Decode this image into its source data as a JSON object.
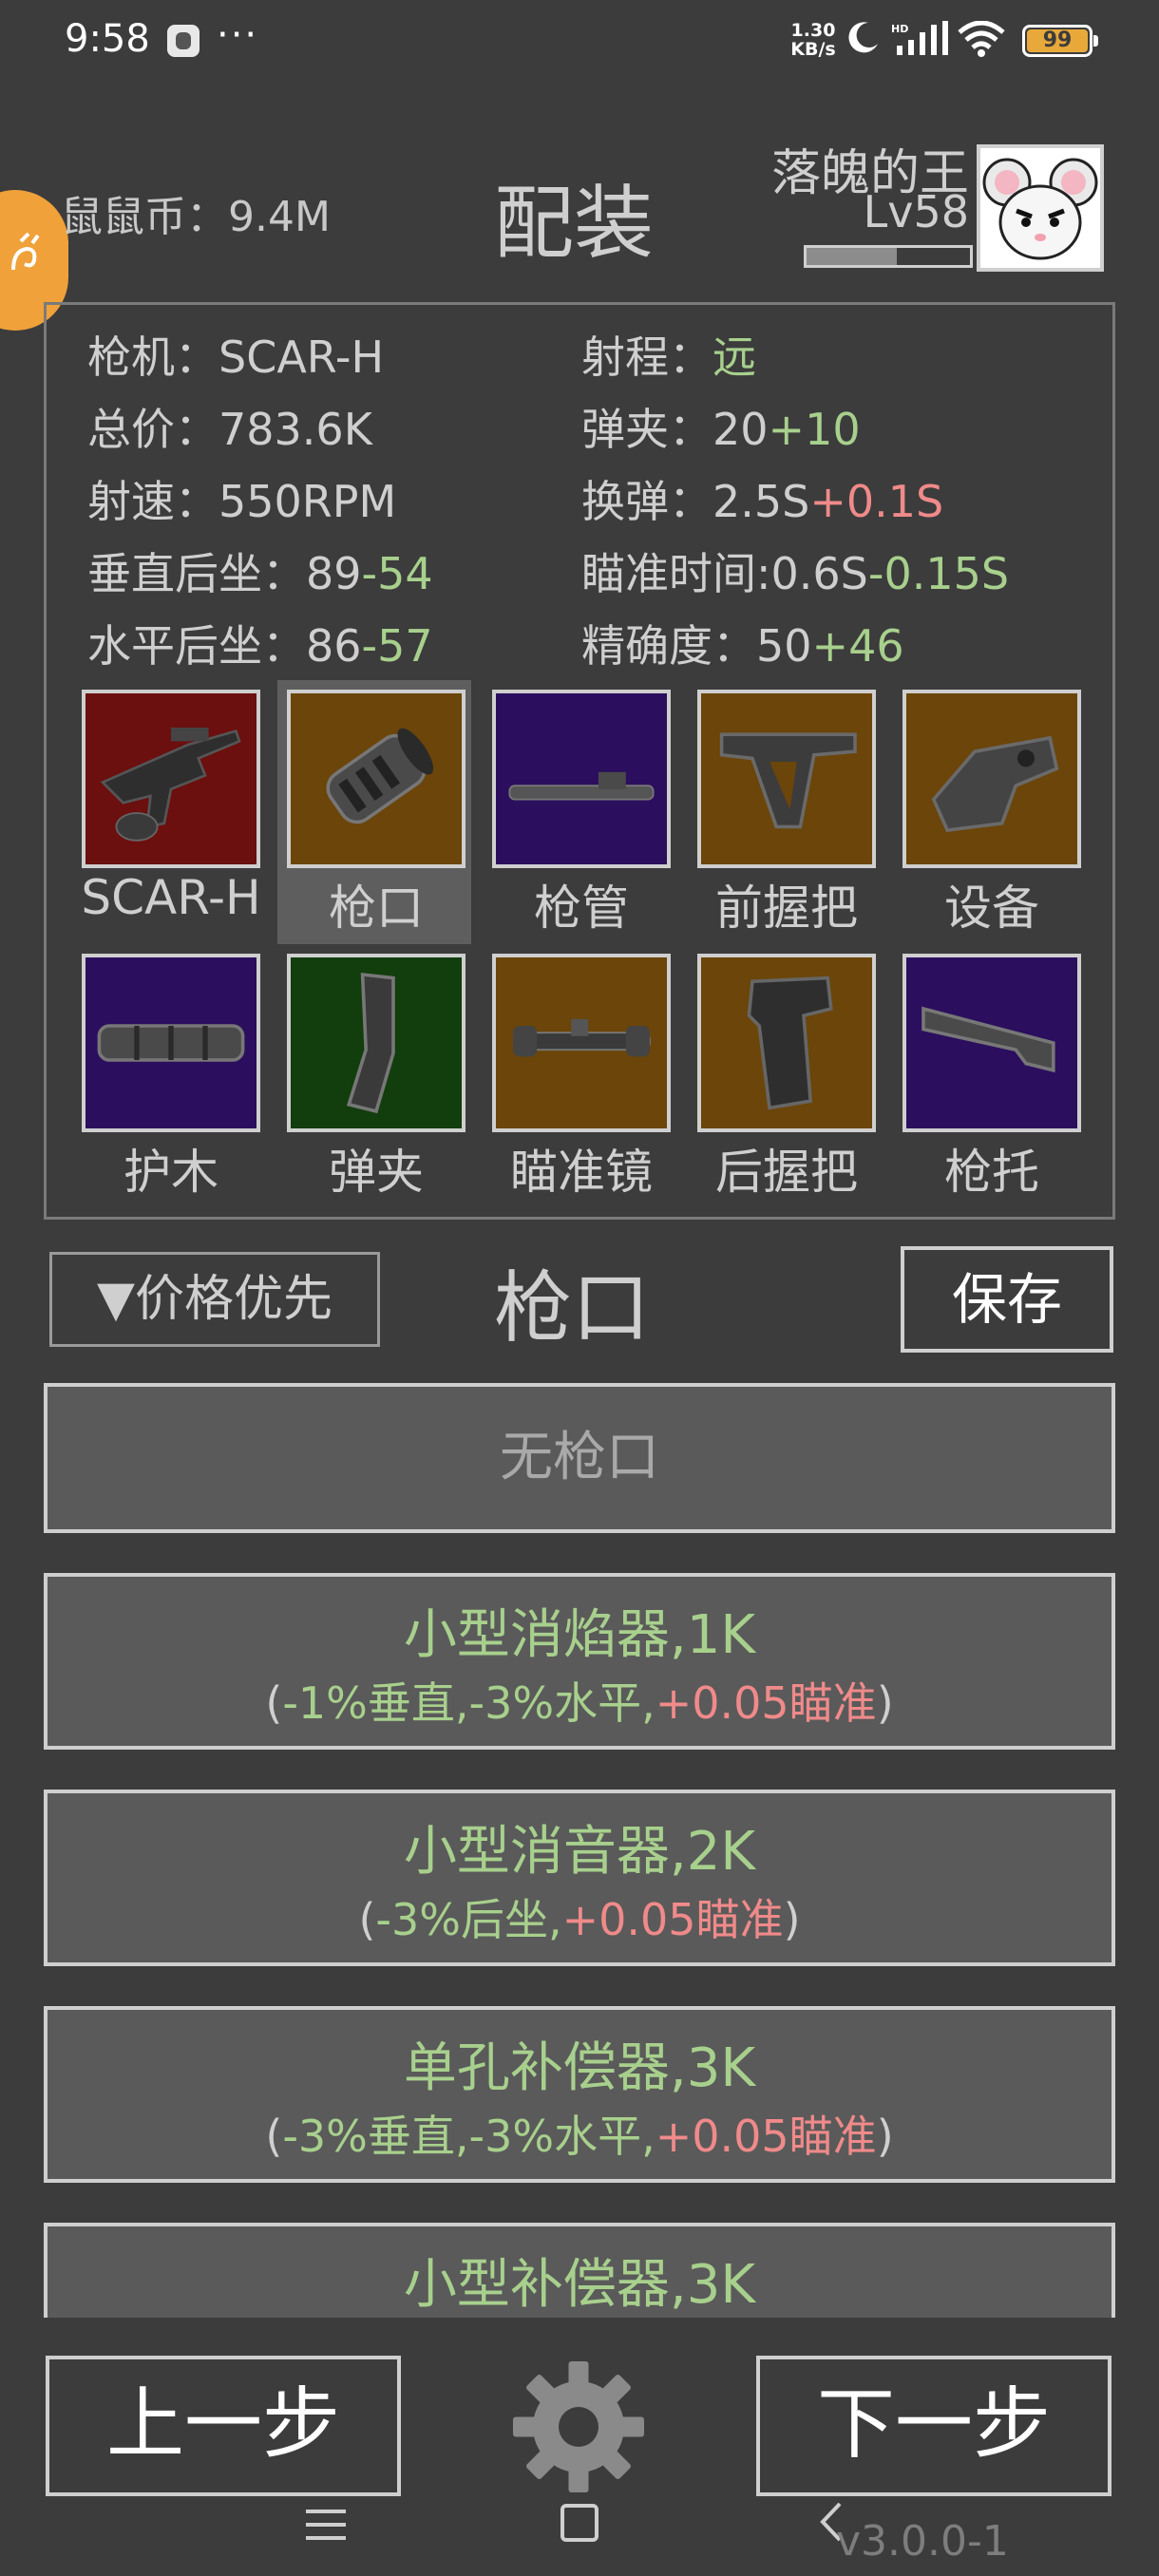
{
  "status_bar": {
    "time": "9:58",
    "dots": "···",
    "speed": "1.30\nKB/s",
    "battery": "99"
  },
  "header": {
    "coin_label": "鼠鼠币：9.4M",
    "title": "配装",
    "player_name": "落魄的王",
    "player_level": "Lv58",
    "xp_progress": 0.55
  },
  "stats": {
    "gun_label": "枪机：",
    "gun_value": "SCAR-H",
    "range_label": "射程：",
    "range_value": "远",
    "price_label": "总价：",
    "price_value": "783.6K",
    "mag_label": "弹夹：",
    "mag_base": "20",
    "mag_mod": "+10",
    "rof_label": "射速：",
    "rof_value": "550RPM",
    "reload_label": "换弹：",
    "reload_base": "2.5S",
    "reload_mod": "+0.1S",
    "vrecoil_label": "垂直后坐：",
    "vrecoil_base": "89",
    "vrecoil_mod": "-54",
    "ads_label": "瞄准时间:",
    "ads_base": "0.6S",
    "ads_mod": "-0.15S",
    "hrecoil_label": "水平后坐：",
    "hrecoil_base": "86",
    "hrecoil_mod": "-57",
    "acc_label": "精确度：",
    "acc_base": "50",
    "acc_mod": "+46"
  },
  "slots": [
    {
      "label": "SCAR-H",
      "icon": "rifle-icon",
      "rarity_color": "#6b0f0f"
    },
    {
      "label": "枪口",
      "icon": "muzzle-icon",
      "rarity_color": "#6b4509"
    },
    {
      "label": "枪管",
      "icon": "barrel-icon",
      "rarity_color": "#2b0f5e"
    },
    {
      "label": "前握把",
      "icon": "foregrip-icon",
      "rarity_color": "#6b4509"
    },
    {
      "label": "设备",
      "icon": "device-icon",
      "rarity_color": "#6b4509"
    },
    {
      "label": "护木",
      "icon": "handguard-icon",
      "rarity_color": "#2b0f5e"
    },
    {
      "label": "弹夹",
      "icon": "magazine-icon",
      "rarity_color": "#123d0c"
    },
    {
      "label": "瞄准镜",
      "icon": "scope-icon",
      "rarity_color": "#6b4509"
    },
    {
      "label": "后握把",
      "icon": "pistol-grip-icon",
      "rarity_color": "#6b4509"
    },
    {
      "label": "枪托",
      "icon": "stock-icon",
      "rarity_color": "#2b0f5e"
    }
  ],
  "controls": {
    "sort_label": "▼价格优先",
    "section_title": "枪口",
    "save_label": "保存"
  },
  "list": {
    "none_label": "无枪口",
    "items": [
      {
        "name": "小型消焰器,1K",
        "p1": "(",
        "g1": "-1%垂直,-3%水平,",
        "r1": "+0.05瞄准",
        "p2": ")"
      },
      {
        "name": "小型消音器,2K",
        "p1": "(",
        "g1": "-3%后坐,",
        "r1": "+0.05瞄准",
        "p2": ")"
      },
      {
        "name": "单孔补偿器,3K",
        "p1": "(",
        "g1": "-3%垂直,-3%水平,",
        "r1": "+0.05瞄准",
        "p2": ")"
      },
      {
        "name": "小型补偿器,3K"
      }
    ]
  },
  "bottom": {
    "prev_label": "上一步",
    "next_label": "下一步",
    "version": "v3.0.0-1"
  },
  "colors": {
    "background": "#3c3c3c",
    "positive": "#a8d08d",
    "negative": "#f08a8a",
    "accent_orange": "#f0a13a"
  }
}
